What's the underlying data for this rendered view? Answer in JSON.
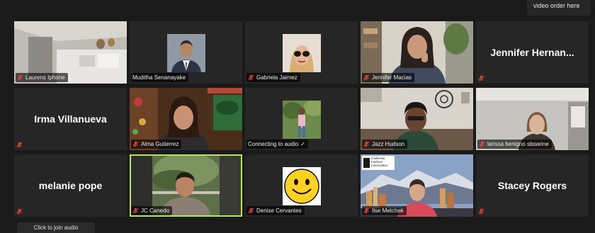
{
  "order_tip": {
    "text": "video order here"
  },
  "tiles": [
    {
      "name": "Laurens Iphone"
    },
    {
      "name": "Muditha Senanayake"
    },
    {
      "name": "Gabriela Jaimez"
    },
    {
      "name": "Jennifer Macias"
    },
    {
      "name": "Jennifer  Hernan..."
    },
    {
      "name": "Irma Villanueva"
    },
    {
      "name": "Alma Gutierrez"
    },
    {
      "name": "Connecting to audio"
    },
    {
      "name": "Jazz Hudson"
    },
    {
      "name": "larissa benigno sboarine"
    },
    {
      "name": "melanie pope"
    },
    {
      "name": "JC Canedo"
    },
    {
      "name": "Denise Cervantes"
    },
    {
      "name": "Ilse Metchek"
    },
    {
      "name": "Stacey Rogers"
    }
  ],
  "california_logo": {
    "line1": "California",
    "line2": "Fashion",
    "line3": "Association"
  },
  "connecting_check": "✓",
  "join_audio_label": "Click to join audio",
  "colors": {
    "active_speaker": "#b8e35a",
    "muted_mic": "#e0453c",
    "tile_bg": "#262626"
  }
}
